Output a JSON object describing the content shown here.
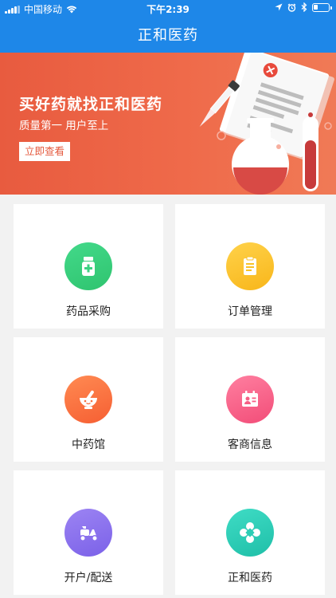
{
  "status_bar": {
    "carrier": "中国移动",
    "time": "下午2:39"
  },
  "nav": {
    "title": "正和医药"
  },
  "banner": {
    "headline": "买好药就找正和医药",
    "subline": "质量第一  用户至上",
    "cta": "立即查看"
  },
  "tiles": [
    {
      "label": "药品采购",
      "icon": "medicine-bottle-icon",
      "color_from": "#43d98a",
      "color_to": "#2fc46f"
    },
    {
      "label": "订单管理",
      "icon": "clipboard-icon",
      "color_from": "#ffd24a",
      "color_to": "#f8b61a"
    },
    {
      "label": "中药馆",
      "icon": "mortar-pestle-icon",
      "color_from": "#ff8a52",
      "color_to": "#f65f33"
    },
    {
      "label": "客商信息",
      "icon": "contact-card-icon",
      "color_from": "#ff7fa0",
      "color_to": "#f24d78"
    },
    {
      "label": "开户/配送",
      "icon": "scooter-icon",
      "color_from": "#9c84f3",
      "color_to": "#7b61e8"
    },
    {
      "label": "正和医药",
      "icon": "brand-logo-icon",
      "color_from": "#3fdcc5",
      "color_to": "#1fbfa8"
    }
  ]
}
